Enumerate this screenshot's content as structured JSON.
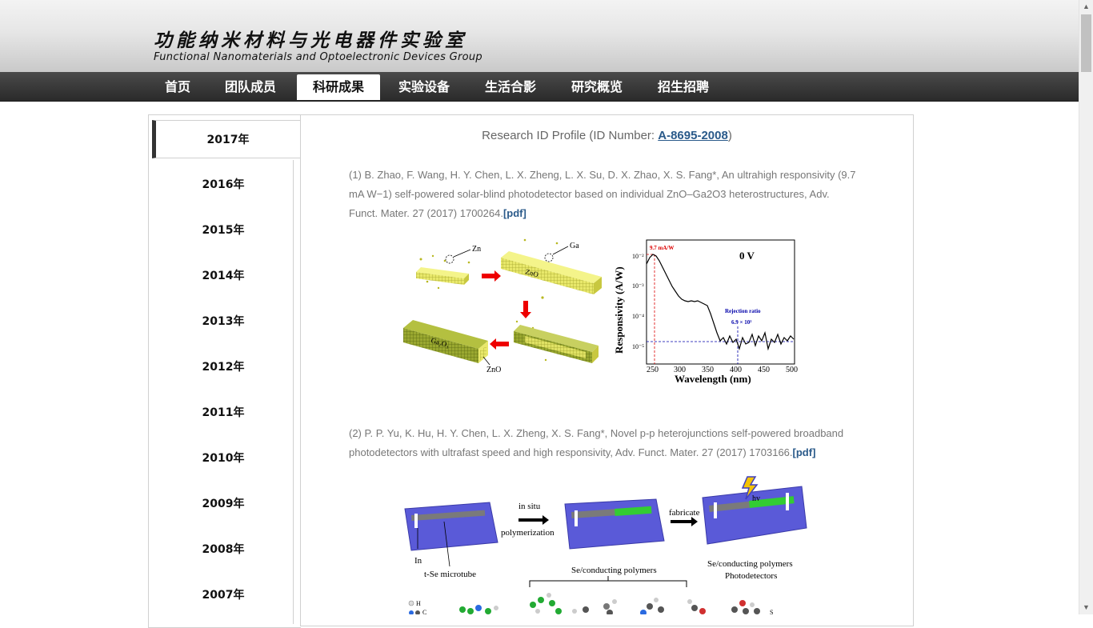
{
  "header": {
    "title_cn": "功能纳米材料与光电器件实验室",
    "title_en": "Functional Nanomaterials and Optoelectronic Devices Group"
  },
  "nav": {
    "items": [
      {
        "label": "首页"
      },
      {
        "label": "团队成员"
      },
      {
        "label": "科研成果",
        "active": true
      },
      {
        "label": "实验设备"
      },
      {
        "label": "生活合影"
      },
      {
        "label": "研究概览"
      },
      {
        "label": "招生招聘"
      }
    ]
  },
  "sidebar": {
    "years": [
      "2017年",
      "2016年",
      "2015年",
      "2014年",
      "2013年",
      "2012年",
      "2011年",
      "2010年",
      "2009年",
      "2008年",
      "2007年"
    ],
    "active": "2017年"
  },
  "main": {
    "profile_prefix": "Research ID Profile (ID Number: ",
    "profile_id": "A-8695-2008",
    "profile_suffix": ")",
    "publications": [
      {
        "text": "(1) B. Zhao, F. Wang, H. Y. Chen, L. X. Zheng, L. X. Su, D. X. Zhao, X. S. Fang*, An ultrahigh responsivity (9.7 mA W−1) self-powered solar-blind photodetector based on individual ZnO–Ga2O3 heterostructures, Adv. Funct. Mater. 27 (2017) 1700264.",
        "pdf": "[pdf]"
      },
      {
        "text": "(2) P. P. Yu, K. Hu, H. Y. Chen, L. X. Zheng, X. S. Fang*, Novel p-p heterojunctions self-powered broadband photodetectors with ultrafast speed and high responsivity, Adv. Funct. Mater. 27 (2017) 1703166.",
        "pdf": "[pdf]"
      }
    ],
    "figure1": {
      "labels": {
        "zn": "Zn",
        "ga": "Ga",
        "zno": "ZnO",
        "zno2": "ZnO",
        "ga2o3": "Ga₂O₃"
      },
      "chart": {
        "ylabel": "Responsivity (A/W)",
        "xlabel": "Wavelength (nm)",
        "bias": "0 V",
        "peak_label": "9.7 mA/W",
        "rejection_title": "Rejection ratio",
        "rejection_value": "6.9 × 10²",
        "yticks": [
          "10⁻²",
          "10⁻³",
          "10⁻⁴",
          "10⁻⁵"
        ],
        "xticks": [
          "250",
          "300",
          "350",
          "400",
          "450",
          "500"
        ]
      }
    },
    "figure2": {
      "labels": {
        "in_situ": "in situ",
        "polymerization": "polymerization",
        "fabricate": "fabricate",
        "hv": "hv",
        "in_label": "In",
        "tse": "t-Se microtube",
        "se_poly": "Se/conducting polymers",
        "se_poly2": "Se/conducting polymers",
        "photodetectors": "Photodetectors",
        "legend_h": "H",
        "legend_c": "C",
        "legend_s": "S"
      }
    }
  },
  "colors": {
    "nav_bg": "#333333",
    "link": "#2a5a8a",
    "zno": "#e8e86a",
    "ga2o3": "#9aa830",
    "substrate": "#5a5ad8",
    "polymer": "#33cc33"
  }
}
